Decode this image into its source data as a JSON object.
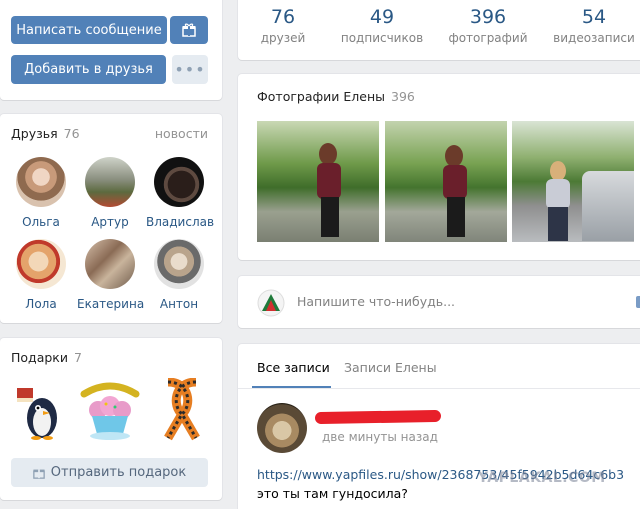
{
  "profile_actions": {
    "write_message": "Написать сообщение",
    "add_friend": "Добавить в друзья"
  },
  "counters": [
    {
      "value": "76",
      "label": "друзей"
    },
    {
      "value": "49",
      "label": "подписчиков"
    },
    {
      "value": "396",
      "label": "фотографий"
    },
    {
      "value": "54",
      "label": "видеозаписи"
    }
  ],
  "friends": {
    "title": "Друзья",
    "count": "76",
    "news_link": "новости",
    "items": [
      {
        "name": "Ольга"
      },
      {
        "name": "Артур"
      },
      {
        "name": "Владислав"
      },
      {
        "name": "Лола"
      },
      {
        "name": "Екатерина"
      },
      {
        "name": "Антон"
      }
    ]
  },
  "gifts": {
    "title": "Подарки",
    "count": "7",
    "send_label": "Отправить подарок"
  },
  "photos": {
    "title": "Фотографии Елены",
    "count": "396"
  },
  "composer": {
    "placeholder": "Напишите что-нибудь..."
  },
  "wall": {
    "tabs": [
      "Все записи",
      "Записи Елены"
    ],
    "post": {
      "time": "две минуты назад",
      "link": "https://www.yapfiles.ru/show/2368753/45f5942b5d64c6b3",
      "text": "это ты там гундосила?"
    }
  },
  "watermark": "YAPLAKAL.COM",
  "colors": {
    "accent": "#5181b8",
    "link": "#2a5885",
    "background": "#edeef0",
    "redaction": "#e8202a"
  }
}
